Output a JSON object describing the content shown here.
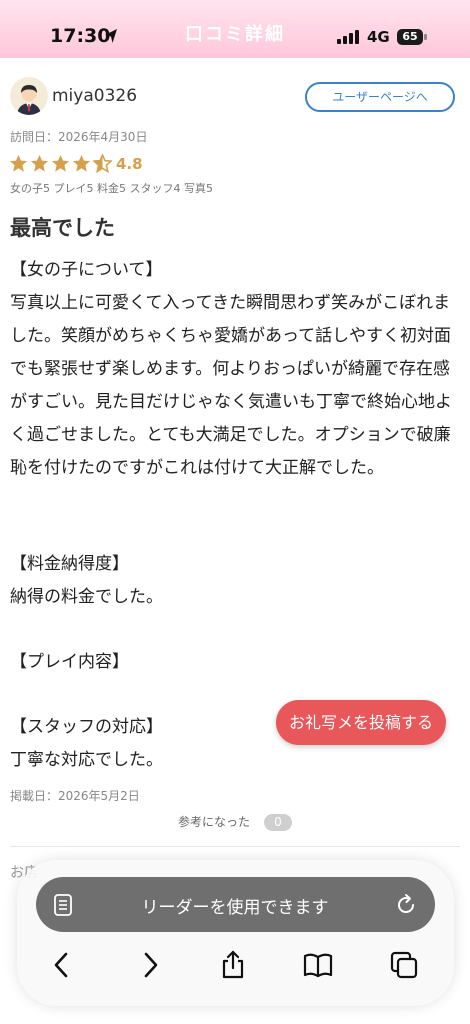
{
  "status_bar": {
    "time": "17:30",
    "network": "4G",
    "battery": "65"
  },
  "header": {
    "title": "口コミ詳細"
  },
  "reviewer": {
    "username": "miya0326",
    "user_page_label": "ユーザーページへ",
    "visit_date": "訪問日：2026年4月30日"
  },
  "rating": {
    "stars_value": 4.5,
    "score": "4.8",
    "breakdown": "女の子5 プレイ5 料金5 スタッフ4 写真5"
  },
  "review": {
    "title": "最高でした",
    "section1_heading": "【女の子について】",
    "section1_body": "写真以上に可愛くて入ってきた瞬間思わず笑みがこぼれました。笑顔がめちゃくちゃ愛嬌があって話しやすく初対面でも緊張せず楽しめます。何よりおっぱいが綺麗で存在感がすごい。見た目だけじゃなく気遣いも丁寧で終始心地よく過ごせました。とても大満足でした。オプションで破廉恥を付けたのですがこれは付けて大正解でした。",
    "section2_heading": "【料金納得度】",
    "section2_body": "納得の料金でした。",
    "section3_heading": "【プレイ内容】",
    "section4_heading": "【スタッフの対応】",
    "section4_body": "丁寧な対応でした。",
    "posted_date": "掲載日：2026年5月2日",
    "helpful_label": "参考になった",
    "helpful_count": "0"
  },
  "fab": {
    "label": "お礼写メを投稿する"
  },
  "below_fold": {
    "faded_text": "お店"
  },
  "safari": {
    "reader_label": "リーダーを使用できます"
  },
  "colors": {
    "header_pink": "#ffc7da",
    "accent_blue": "#3b82c8",
    "fab_red": "#e8575a",
    "star_gold": "#d4a04c"
  }
}
